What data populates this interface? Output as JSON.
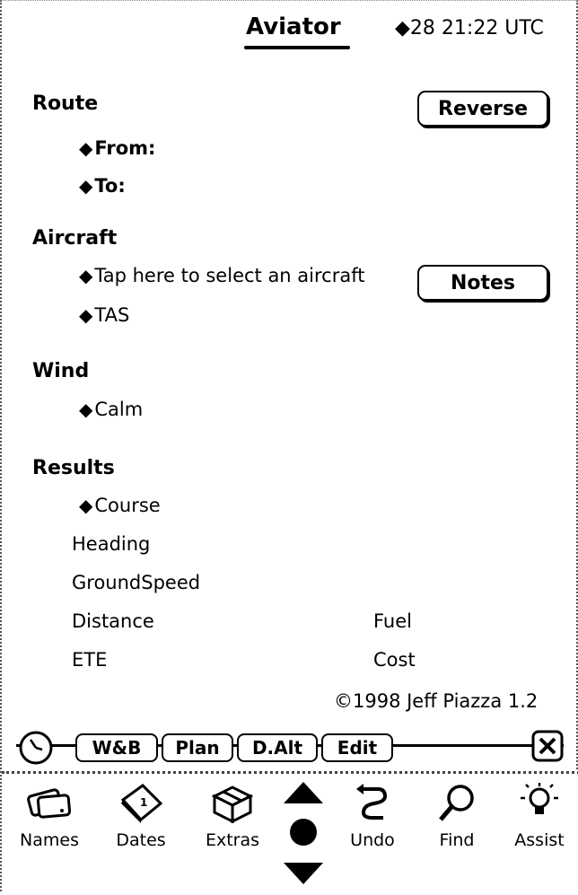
{
  "header": {
    "title": "Aviator",
    "clock": "28 21:22 UTC"
  },
  "route": {
    "heading": "Route",
    "reverse_label": "Reverse",
    "from_label": "From:",
    "to_label": "To:"
  },
  "aircraft": {
    "heading": "Aircraft",
    "select_label": "Tap here to select an aircraft",
    "notes_label": "Notes",
    "tas_label": "TAS"
  },
  "wind": {
    "heading": "Wind",
    "value": "Calm"
  },
  "results": {
    "heading": "Results",
    "course": "Course",
    "heading_label": "Heading",
    "groundspeed": "GroundSpeed",
    "distance": "Distance",
    "fuel": "Fuel",
    "ete": "ETE",
    "cost": "Cost"
  },
  "copyright": "©1998 Jeff Piazza  1.2",
  "tabs": {
    "wb": "W&B",
    "plan": "Plan",
    "dalt": "D.Alt",
    "edit": "Edit"
  },
  "tray": {
    "names": "Names",
    "dates": "Dates",
    "extras": "Extras",
    "undo": "Undo",
    "find": "Find",
    "assist": "Assist"
  }
}
